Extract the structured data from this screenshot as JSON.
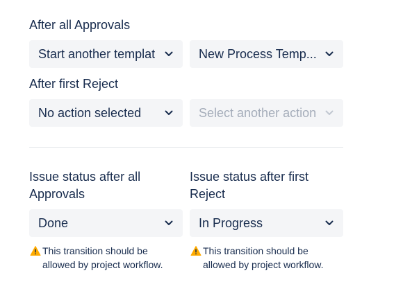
{
  "approvals_section": {
    "label": "After all Approvals",
    "action_select": {
      "value": "Start another templat"
    },
    "template_select": {
      "value": "New Process Temp..."
    }
  },
  "reject_section": {
    "label": "After first Reject",
    "action_select": {
      "value": "No action selected"
    },
    "secondary_select": {
      "placeholder": "Select another action"
    }
  },
  "status_section": {
    "approvals_label": "Issue status after all Approvals",
    "reject_label": "Issue status after first Reject",
    "approvals_select": {
      "value": "Done"
    },
    "reject_select": {
      "value": "In Progress"
    },
    "warning_text": "This transition should be allowed by project workflow.",
    "warning_icon": "warning-triangle-icon"
  },
  "colors": {
    "text": "#172b4d",
    "select_bg": "#f4f5f7",
    "placeholder": "#a5adba",
    "warning": "#ffab00"
  }
}
